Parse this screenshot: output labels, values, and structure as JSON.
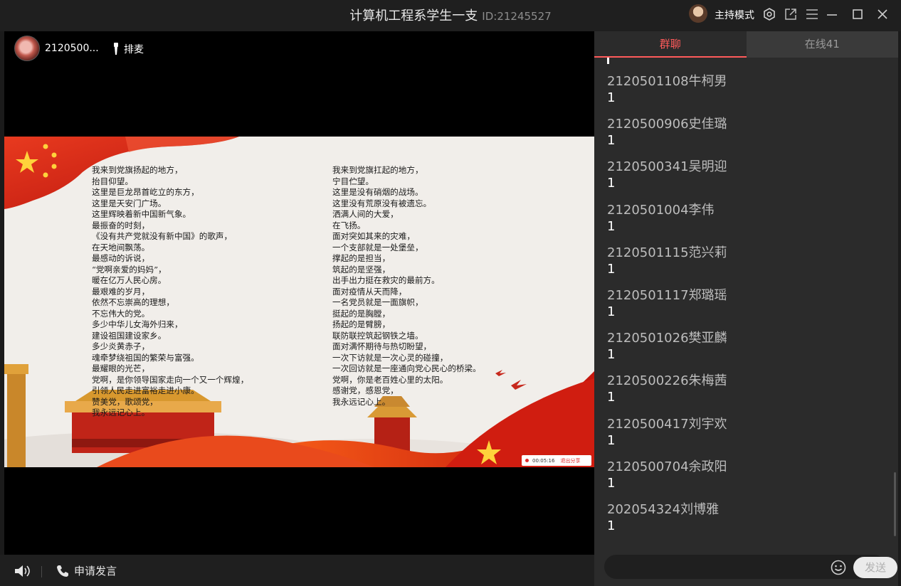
{
  "window": {
    "group_name": "计算机工程系学生一支",
    "group_id": "ID:21245527",
    "mode_label": "主持模式",
    "icons": [
      "settings-icon",
      "popout-icon",
      "menu-icon",
      "minimize-icon",
      "maximize-icon",
      "close-icon"
    ]
  },
  "presenter": {
    "name": "2120500...",
    "queue_label": "排麦"
  },
  "slide": {
    "poem_left": "我来到党旗扬起的地方，\n抬目仰望。\n这里是巨龙昂首屹立的东方，\n这里是天安门广场。\n这里辉映着新中国新气象。\n最振奋的时刻，\n《没有共产党就没有新中国》的歌声，\n在天地间飘荡。\n最感动的诉说，\n“党啊亲爱的妈妈”，\n暖在亿万人民心房。\n最艰难的岁月，\n依然不忘崇高的理想，\n不忘伟大的党。\n多少中华儿女海外归来，\n建设祖国建设家乡。\n多少炎黄赤子，\n魂牵梦绕祖国的繁荣与富强。\n最耀眼的光芒，\n党啊，是你领导国家走向一个又一个辉煌，\n引领人民走进富裕走进小康。\n赞美党，歌颂党，\n我永远记心上。",
    "poem_right": "我来到党旗扛起的地方，\n宁目伫望。\n这里是没有硝烟的战场。\n这里没有荒原没有被遗忘。\n洒满人间的大爱，\n在飞扬。\n面对突如其来的灾难，\n一个支部就是一处堡垒，\n撑起的是担当，\n筑起的是坚强，\n出手出力挺在救灾的最前方。\n面对疫情从天而降，\n一名党员就是一面旗帜，\n挺起的是胸膛，\n扬起的是臂膀，\n联防联控筑起钢铁之墙。\n面对满怀期待与热切盼望，\n一次下访就是一次心灵的碰撞，\n一次回访就是一座通向党心民心的桥梁。\n党啊，你是老百姓心里的太阳。\n感谢党，感恩党，\n我永远记心上。",
    "share_time": "00:05:16",
    "share_stop": "退出分享"
  },
  "controls": {
    "apply_label": "申请发言"
  },
  "chat": {
    "tab_group": "群聊",
    "tab_online": "在线41",
    "messages": [
      {
        "sender": "2120501108牛柯男",
        "text": "1"
      },
      {
        "sender": "2120500906史佳璐",
        "text": "1"
      },
      {
        "sender": "2120500341吴明迎",
        "text": "1"
      },
      {
        "sender": "2120501004李伟",
        "text": "1"
      },
      {
        "sender": "2120501115范兴莉",
        "text": "1"
      },
      {
        "sender": "2120501117郑璐瑶",
        "text": "1"
      },
      {
        "sender": "2120501026樊亚麟",
        "text": "1"
      },
      {
        "sender": "2120500226朱梅茜",
        "text": "1"
      },
      {
        "sender": "2120500417刘宇欢",
        "text": "1"
      },
      {
        "sender": "2120500704余政阳",
        "text": "1"
      },
      {
        "sender": "202054324刘博雅",
        "text": "1"
      }
    ],
    "send_label": "发送",
    "accent": "#ff5a5a"
  }
}
